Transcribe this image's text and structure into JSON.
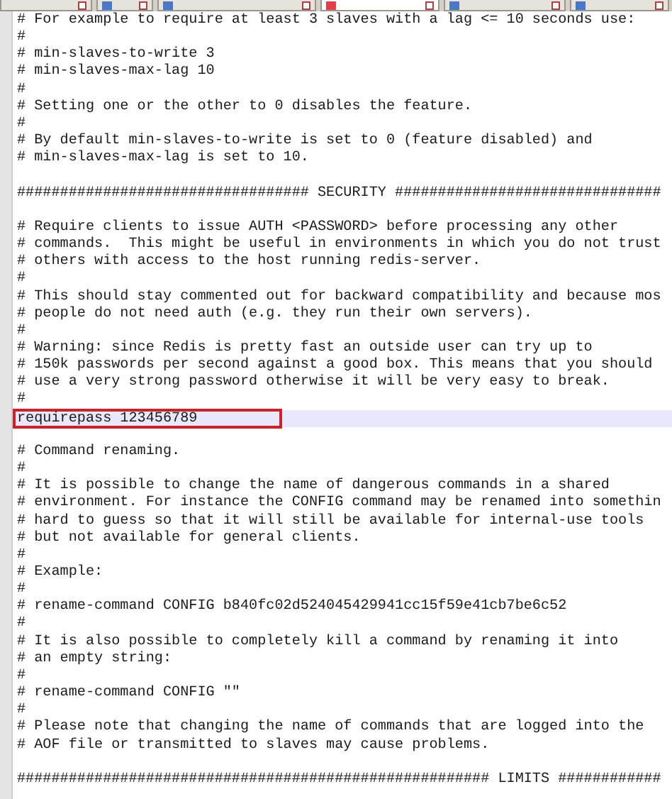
{
  "tabs": [
    {
      "kind": "plain",
      "selected": false
    },
    {
      "kind": "file",
      "selected": false
    },
    {
      "kind": "file",
      "selected": false
    },
    {
      "kind": "file",
      "selected": true
    },
    {
      "kind": "file",
      "selected": false
    },
    {
      "kind": "file",
      "selected": false
    }
  ],
  "lines": [
    {
      "text": "# For example to require at least 3 slaves with a lag <= 10 seconds use:",
      "current": false,
      "marked": false
    },
    {
      "text": "#",
      "current": false,
      "marked": false
    },
    {
      "text": "# min-slaves-to-write 3",
      "current": false,
      "marked": false
    },
    {
      "text": "# min-slaves-max-lag 10",
      "current": false,
      "marked": false
    },
    {
      "text": "#",
      "current": false,
      "marked": false
    },
    {
      "text": "# Setting one or the other to 0 disables the feature.",
      "current": false,
      "marked": false
    },
    {
      "text": "#",
      "current": false,
      "marked": false
    },
    {
      "text": "# By default min-slaves-to-write is set to 0 (feature disabled) and",
      "current": false,
      "marked": false
    },
    {
      "text": "# min-slaves-max-lag is set to 10.",
      "current": false,
      "marked": false
    },
    {
      "current": false,
      "marked": false
    },
    {
      "text": "################################## SECURITY ###############################",
      "current": false,
      "marked": false
    },
    {
      "current": false,
      "marked": false
    },
    {
      "text": "# Require clients to issue AUTH <PASSWORD> before processing any other",
      "current": false,
      "marked": false
    },
    {
      "text": "# commands.  This might be useful in environments in which you do not trust",
      "current": false,
      "marked": false
    },
    {
      "text": "# others with access to the host running redis-server.",
      "current": false,
      "marked": false
    },
    {
      "text": "#",
      "current": false,
      "marked": false
    },
    {
      "text": "# This should stay commented out for backward compatibility and because mos",
      "current": false,
      "marked": false
    },
    {
      "text": "# people do not need auth (e.g. they run their own servers).",
      "current": false,
      "marked": false
    },
    {
      "text": "#",
      "current": false,
      "marked": false
    },
    {
      "text": "# Warning: since Redis is pretty fast an outside user can try up to",
      "current": false,
      "marked": false
    },
    {
      "text": "# 150k passwords per second against a good box. This means that you should",
      "current": false,
      "marked": false
    },
    {
      "text": "# use a very strong password otherwise it will be very easy to break.",
      "current": false,
      "marked": false
    },
    {
      "text": "#",
      "current": false,
      "marked": false
    },
    {
      "text": "requirepass 123456789",
      "current": true,
      "marked": true
    },
    {
      "current": false,
      "marked": false
    },
    {
      "text": "# Command renaming.",
      "current": false,
      "marked": false
    },
    {
      "text": "#",
      "current": false,
      "marked": false
    },
    {
      "text": "# It is possible to change the name of dangerous commands in a shared",
      "current": false,
      "marked": false
    },
    {
      "text": "# environment. For instance the CONFIG command may be renamed into somethin",
      "current": false,
      "marked": false
    },
    {
      "text": "# hard to guess so that it will still be available for internal-use tools",
      "current": false,
      "marked": false
    },
    {
      "text": "# but not available for general clients.",
      "current": false,
      "marked": false
    },
    {
      "text": "#",
      "current": false,
      "marked": false
    },
    {
      "text": "# Example:",
      "current": false,
      "marked": false
    },
    {
      "text": "#",
      "current": false,
      "marked": false
    },
    {
      "text": "# rename-command CONFIG b840fc02d524045429941cc15f59e41cb7be6c52",
      "current": false,
      "marked": false
    },
    {
      "text": "#",
      "current": false,
      "marked": false
    },
    {
      "text": "# It is also possible to completely kill a command by renaming it into",
      "current": false,
      "marked": false
    },
    {
      "text": "# an empty string:",
      "current": false,
      "marked": false
    },
    {
      "text": "#",
      "current": false,
      "marked": false
    },
    {
      "text": "# rename-command CONFIG \"\"",
      "current": false,
      "marked": false
    },
    {
      "text": "#",
      "current": false,
      "marked": false
    },
    {
      "text": "# Please note that changing the name of commands that are logged into the",
      "current": false,
      "marked": false
    },
    {
      "text": "# AOF file or transmitted to slaves may cause problems.",
      "current": false,
      "marked": false
    },
    {
      "current": false,
      "marked": false
    },
    {
      "text": "####################################################### LIMITS ############",
      "current": false,
      "marked": false
    }
  ]
}
